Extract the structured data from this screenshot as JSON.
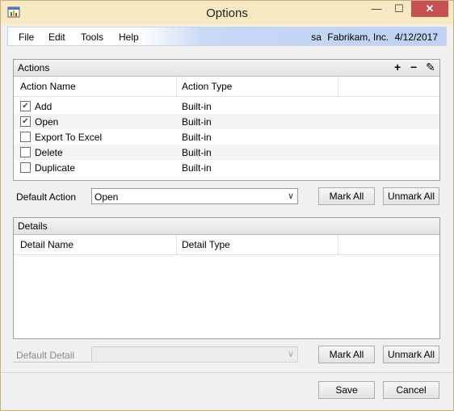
{
  "window": {
    "title": "Options",
    "minimize": "—",
    "maximize": "☐",
    "close": "✕"
  },
  "menu": {
    "items": [
      "File",
      "Edit",
      "Tools",
      "Help"
    ]
  },
  "user": {
    "name": "sa",
    "company": "Fabrikam, Inc.",
    "date": "4/12/2017"
  },
  "actions": {
    "title": "Actions",
    "add_icon": "+",
    "remove_icon": "−",
    "edit_icon": "✎",
    "columns": [
      "Action Name",
      "Action Type"
    ],
    "rows": [
      {
        "name": "Add",
        "type": "Built-in",
        "checked": true
      },
      {
        "name": "Open",
        "type": "Built-in",
        "checked": true
      },
      {
        "name": "Export To Excel",
        "type": "Built-in",
        "checked": false
      },
      {
        "name": "Delete",
        "type": "Built-in",
        "checked": false
      },
      {
        "name": "Duplicate",
        "type": "Built-in",
        "checked": false
      }
    ],
    "default_label": "Default Action",
    "default_value": "Open",
    "mark_all": "Mark All",
    "unmark_all": "Unmark All"
  },
  "details": {
    "title": "Details",
    "columns": [
      "Detail Name",
      "Detail Type"
    ],
    "default_label": "Default Detail",
    "default_value": "",
    "mark_all": "Mark All",
    "unmark_all": "Unmark All"
  },
  "footer": {
    "save": "Save",
    "cancel": "Cancel"
  },
  "glyphs": {
    "check": "✔",
    "dropdown": "∨"
  }
}
